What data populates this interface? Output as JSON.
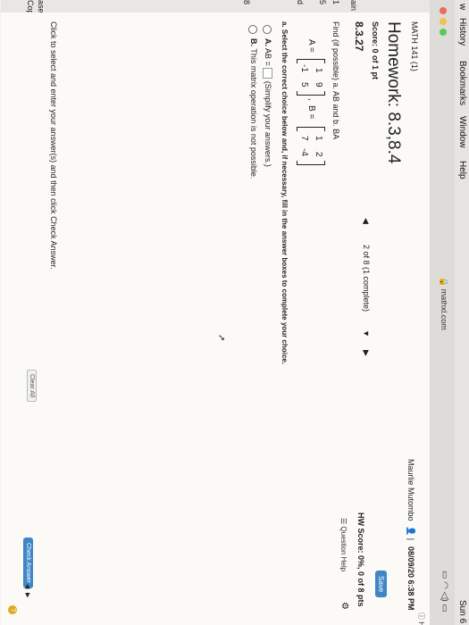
{
  "menu": {
    "item0": "w",
    "items": [
      "History",
      "Bookmarks",
      "Window",
      "Help"
    ],
    "time": "Sun 6"
  },
  "browser": {
    "url": "mathxl.com"
  },
  "course": {
    "title": "MATH 141 (1)"
  },
  "user": {
    "name": "Maurlie Mutombo",
    "datetime": "08/09/20 6:38 PM"
  },
  "hw": {
    "title": "Homework: 8.3,8.4",
    "score": "Score: 0 of 1 pt",
    "question_id": "8.3.27",
    "nav": "2 of 8 (1 complete)",
    "hw_score": "HW Score: 0%, 0 of 8 pts",
    "save_label": "Save",
    "help_label": "Question Help",
    "side_help": "He"
  },
  "question": {
    "prompt": "Find (if possible) a. AB and b. BA",
    "A_label": "A =",
    "A": [
      [
        "1",
        "9"
      ],
      [
        "-1",
        "5"
      ]
    ],
    "B_label": "B =",
    "B": [
      [
        "1",
        "2"
      ],
      [
        "7",
        "-4"
      ]
    ],
    "instruction": "a. Select the correct choice below and, if necessary, fill in the answer boxes to complete your choice.",
    "option_a_label": "A.",
    "option_a_text": "AB =",
    "option_a_note": "(Simplify your answers.)",
    "option_b_label": "B.",
    "option_b_text": "This matrix operation is not possible."
  },
  "footer": {
    "hint": "Click to select and enter your answer(s) and then click Check Answer.",
    "clear_all": "Clear All",
    "check_answer": "Check Answer"
  },
  "sidebar_fragments": [
    "ased",
    "Copyr",
    "d",
    "8",
    "1",
    "5",
    "ain"
  ],
  "colors": {
    "accent": "#3f86c8",
    "help_icon": "#e0a820"
  }
}
